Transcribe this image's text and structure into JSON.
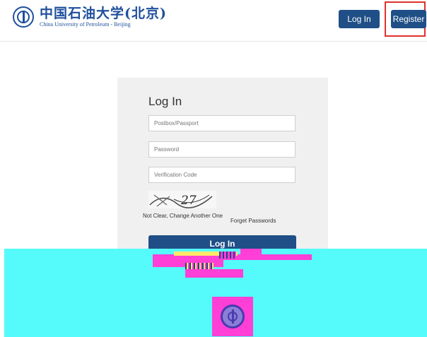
{
  "header": {
    "logo_cn": "中国石油大学(北京)",
    "logo_en": "China University of Petroleum - Beijing",
    "login_label": "Log In",
    "register_label": "Register"
  },
  "form": {
    "title": "Log In",
    "postbox_placeholder": "Postbox/Passport",
    "password_placeholder": "Password",
    "code_placeholder": "Verification Code",
    "captcha_text": "27",
    "change_link": "Not Clear, Change Another One",
    "forgot_link": "Forget Passwords",
    "submit_label": "Log In"
  },
  "colors": {
    "brand": "#1f4f86",
    "highlight": "#e0302c",
    "overlay": "#55fbfb"
  }
}
